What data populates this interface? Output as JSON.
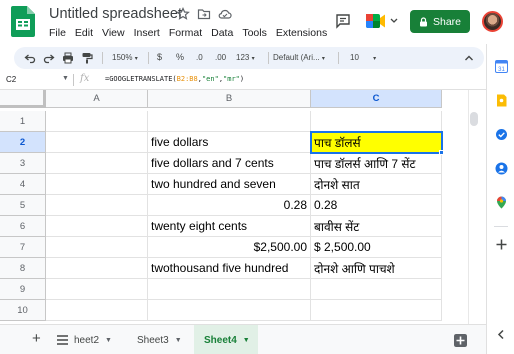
{
  "app": {
    "doc_title": "Untitled spreadsheet",
    "menu": [
      "File",
      "Edit",
      "View",
      "Insert",
      "Format",
      "Data",
      "Tools",
      "Extensions"
    ],
    "share_label": "Share"
  },
  "toolbar": {
    "zoom": "150%",
    "currency": "$",
    "percent": "%",
    "decimal_decrease": ".0",
    "decimal_increase": ".00",
    "more_formats": "123",
    "font": "Default (Ari...",
    "font_size": "10"
  },
  "formula_bar": {
    "cell_ref": "C2",
    "fx": "fx",
    "formula_prefix": "=GOOGLETRANSLATE(",
    "formula_range": "B2:B8",
    "formula_sep1": ",",
    "formula_arg1": "\"en\"",
    "formula_sep2": ",",
    "formula_arg2": "\"mr\"",
    "formula_suffix": ")"
  },
  "grid": {
    "columns": [
      "A",
      "B",
      "C"
    ],
    "rows": [
      "1",
      "2",
      "3",
      "4",
      "5",
      "6",
      "7",
      "8",
      "9",
      "10"
    ],
    "cells": {
      "B2": "five dollars",
      "C2": "पाच डॉलर्स",
      "B3": "five dollars and 7 cents",
      "C3": "पाच डॉलर्स आणि 7 सेंट",
      "B4": "two hundred and seven",
      "C4": "दोनशे सात",
      "B5": "0.28",
      "C5": "0.28",
      "B6": "twenty eight cents",
      "C6": "बावीस सेंट",
      "B7": "$2,500.00",
      "C7": "$ 2,500.00",
      "B8": "twothousand five hundred",
      "C8": "दोनशे आणि पाचशे"
    },
    "highlight_color": "#ffff00",
    "selection_color": "#1a73e8"
  },
  "sheets": {
    "tabs": [
      "heet2",
      "Sheet3",
      "Sheet4"
    ],
    "active": "Sheet4"
  },
  "colors": {
    "share_green": "#188038",
    "active_tab_bg": "#e1f0e6"
  }
}
